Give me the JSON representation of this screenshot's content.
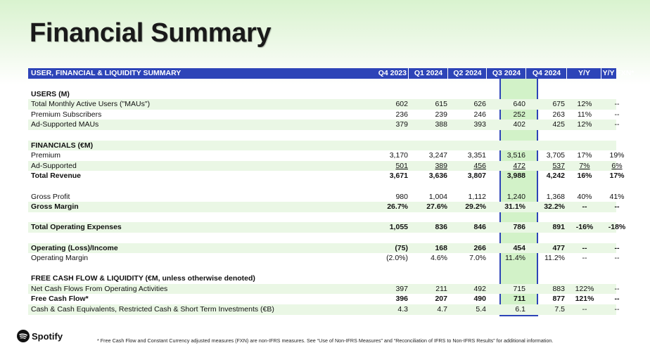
{
  "title": "Financial Summary",
  "table": {
    "header_label": "USER, FINANCIAL & LIQUIDITY SUMMARY",
    "columns": [
      "Q4 2023",
      "Q1 2024",
      "Q2 2024",
      "Q3 2024",
      "Q4 2024",
      "Y/Y",
      "Y/Y FXN*"
    ],
    "highlight_column": "Q4 2024",
    "colors": {
      "header_bg": "#2d44b8",
      "highlight_bg": "#d2f2c8",
      "row_shade": "#eaf7e5"
    },
    "rows": [
      {
        "type": "gap"
      },
      {
        "type": "section",
        "label": "USERS (M)"
      },
      {
        "type": "data",
        "label": "Total Monthly Active Users (\"MAUs\")",
        "values": [
          "602",
          "615",
          "626",
          "640",
          "675",
          "12%",
          "--"
        ]
      },
      {
        "type": "data",
        "label": "Premium Subscribers",
        "values": [
          "236",
          "239",
          "246",
          "252",
          "263",
          "11%",
          "--"
        ]
      },
      {
        "type": "data",
        "label": "Ad-Supported MAUs",
        "values": [
          "379",
          "388",
          "393",
          "402",
          "425",
          "12%",
          "--"
        ]
      },
      {
        "type": "gap"
      },
      {
        "type": "section",
        "label": "FINANCIALS (€M)"
      },
      {
        "type": "data",
        "label": "Premium",
        "values": [
          "3,170",
          "3,247",
          "3,351",
          "3,516",
          "3,705",
          "17%",
          "19%"
        ]
      },
      {
        "type": "data",
        "label": "Ad-Supported",
        "values": [
          "501",
          "389",
          "456",
          "472",
          "537",
          "7%",
          "6%"
        ],
        "underline": true
      },
      {
        "type": "bold",
        "label": "Total Revenue",
        "values": [
          "3,671",
          "3,636",
          "3,807",
          "3,988",
          "4,242",
          "16%",
          "17%"
        ]
      },
      {
        "type": "gap"
      },
      {
        "type": "data",
        "label": "Gross Profit",
        "values": [
          "980",
          "1,004",
          "1,112",
          "1,240",
          "1,368",
          "40%",
          "41%"
        ]
      },
      {
        "type": "bold",
        "label": "Gross Margin",
        "values": [
          "26.7%",
          "27.6%",
          "29.2%",
          "31.1%",
          "32.2%",
          "--",
          "--"
        ]
      },
      {
        "type": "gap"
      },
      {
        "type": "bold",
        "label": "Total Operating Expenses",
        "values": [
          "1,055",
          "836",
          "846",
          "786",
          "891",
          "-16%",
          "-18%"
        ]
      },
      {
        "type": "gap"
      },
      {
        "type": "bold",
        "label": "Operating (Loss)/Income",
        "values": [
          "(75)",
          "168",
          "266",
          "454",
          "477",
          "--",
          "--"
        ]
      },
      {
        "type": "data",
        "label": "Operating Margin",
        "values": [
          "(2.0%)",
          "4.6%",
          "7.0%",
          "11.4%",
          "11.2%",
          "--",
          "--"
        ]
      },
      {
        "type": "gap"
      },
      {
        "type": "section",
        "label": "FREE CASH FLOW & LIQUIDITY (€M, unless otherwise denoted)"
      },
      {
        "type": "data",
        "label": "Net Cash Flows From Operating Activities",
        "values": [
          "397",
          "211",
          "492",
          "715",
          "883",
          "122%",
          "--"
        ]
      },
      {
        "type": "bold",
        "label": "Free Cash Flow*",
        "values": [
          "396",
          "207",
          "490",
          "711",
          "877",
          "121%",
          "--"
        ]
      },
      {
        "type": "data",
        "label": "Cash & Cash Equivalents, Restricted Cash & Short Term Investments (€B)",
        "values": [
          "4.3",
          "4.7",
          "5.4",
          "6.1",
          "7.5",
          "--",
          "--"
        ]
      }
    ]
  },
  "footer": {
    "logo_text": "Spotify",
    "logo_icon": "spotify-logo-icon",
    "footnote": "* Free Cash Flow and Constant Currency adjusted measures (FXN) are non-IFRS measures. See “Use of Non-IFRS Measures” and “Reconciliation of IFRS to Non-IFRS Results” for additional information."
  }
}
